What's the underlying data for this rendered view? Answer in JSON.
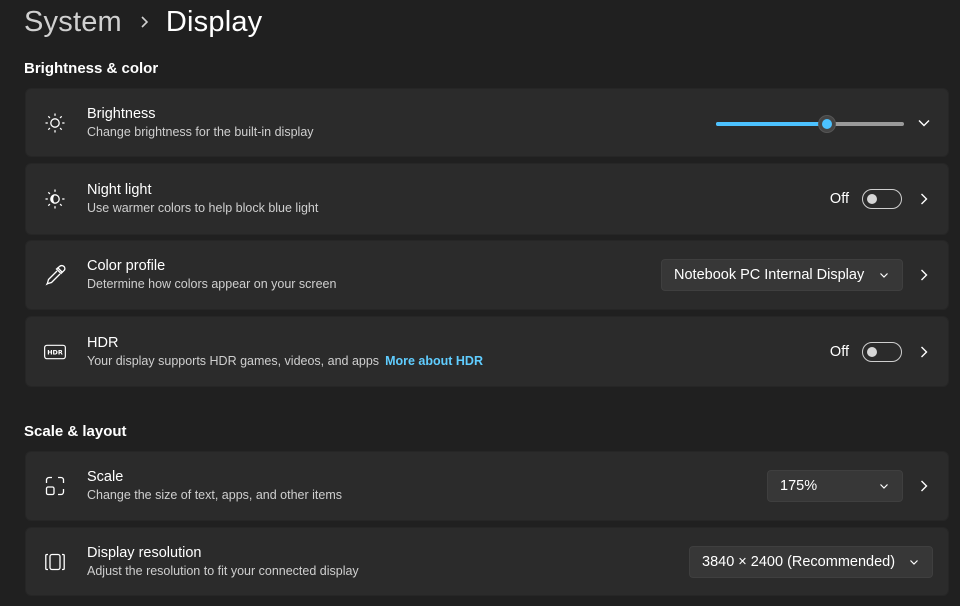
{
  "breadcrumb": {
    "parent": "System",
    "current": "Display"
  },
  "sections": {
    "brightness_color": "Brightness & color",
    "scale_layout": "Scale & layout"
  },
  "brightness": {
    "title": "Brightness",
    "description": "Change brightness for the built-in display",
    "level_percent": 59
  },
  "night_light": {
    "title": "Night light",
    "description": "Use warmer colors to help block blue light",
    "state": "Off"
  },
  "color_profile": {
    "title": "Color profile",
    "description": "Determine how colors appear on your screen",
    "selected": "Notebook PC Internal Display"
  },
  "hdr": {
    "title": "HDR",
    "description": "Your display supports HDR games, videos, and apps",
    "link": "More about HDR",
    "state": "Off",
    "icon_text": "HDR"
  },
  "scale": {
    "title": "Scale",
    "description": "Change the size of text, apps, and other items",
    "selected": "175%"
  },
  "resolution": {
    "title": "Display resolution",
    "description": "Adjust the resolution to fit your connected display",
    "selected": "3840 × 2400 (Recommended)"
  },
  "colors": {
    "background": "#202020",
    "card": "#2b2b2b",
    "accent": "#4cc2ff",
    "link": "#60cdff"
  }
}
